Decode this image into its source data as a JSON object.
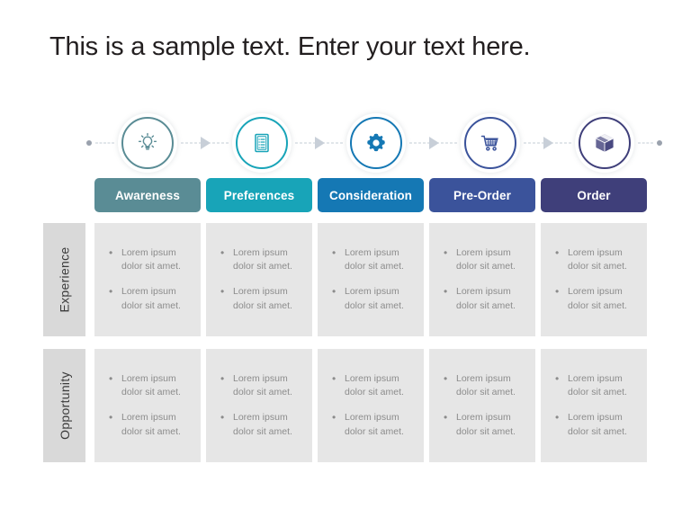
{
  "slide": {
    "title": "This is a sample text. Enter your text here."
  },
  "process": {
    "start_marker": "dot",
    "end_marker": "dot",
    "connector_style": "dashed-arrow",
    "stages": [
      {
        "label": "Awareness",
        "icon": "lightbulb-icon",
        "color": "#5a8c95",
        "tab_color": "#5a8c95"
      },
      {
        "label": "Preferences",
        "icon": "clipboard-list-icon",
        "color": "#18a4b8",
        "tab_color": "#18a4b8"
      },
      {
        "label": "Consideration",
        "icon": "gear-icon",
        "color": "#1578b4",
        "tab_color": "#1578b4"
      },
      {
        "label": "Pre-Order",
        "icon": "shopping-cart-icon",
        "color": "#3b539b",
        "tab_color": "#3b539b"
      },
      {
        "label": "Order",
        "icon": "package-box-icon",
        "color": "#3f3f7a",
        "tab_color": "#3f3f7a"
      }
    ]
  },
  "matrix": {
    "rows": [
      {
        "label": "Experience",
        "cells": [
          {
            "bullets": [
              "Lorem ipsum dolor sit amet.",
              "Lorem ipsum dolor sit amet."
            ]
          },
          {
            "bullets": [
              "Lorem ipsum dolor sit amet.",
              "Lorem ipsum dolor sit amet."
            ]
          },
          {
            "bullets": [
              "Lorem ipsum dolor sit amet.",
              "Lorem ipsum dolor sit amet."
            ]
          },
          {
            "bullets": [
              "Lorem ipsum dolor sit amet.",
              "Lorem ipsum dolor sit amet."
            ]
          },
          {
            "bullets": [
              "Lorem ipsum dolor sit amet.",
              "Lorem ipsum dolor sit amet."
            ]
          }
        ]
      },
      {
        "label": "Opportunity",
        "cells": [
          {
            "bullets": [
              "Lorem ipsum dolor sit amet.",
              "Lorem ipsum dolor sit amet."
            ]
          },
          {
            "bullets": [
              "Lorem ipsum dolor sit amet.",
              "Lorem ipsum dolor sit amet."
            ]
          },
          {
            "bullets": [
              "Lorem ipsum dolor sit amet.",
              "Lorem ipsum dolor sit amet."
            ]
          },
          {
            "bullets": [
              "Lorem ipsum dolor sit amet.",
              "Lorem ipsum dolor sit amet."
            ]
          },
          {
            "bullets": [
              "Lorem ipsum dolor sit amet.",
              "Lorem ipsum dolor sit amet."
            ]
          }
        ]
      }
    ]
  },
  "theme": {
    "background": "#ffffff",
    "title_color": "#231f20",
    "row_label_bg": "#d9d9d9",
    "cell_bg": "#e6e6e6",
    "body_text_color": "#8c8c8c",
    "connector_color": "#c3ccd6"
  }
}
